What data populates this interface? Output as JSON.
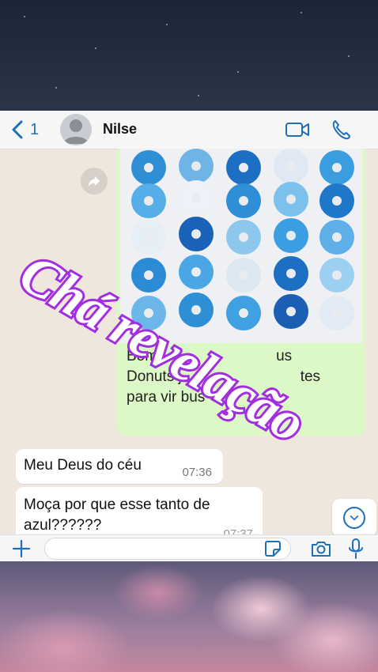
{
  "header": {
    "back_count": "1",
    "contact_name": "Nilse"
  },
  "chat": {
    "outgoing": {
      "caption_lines": [
        "Bom",
        "us",
        "Donuts j",
        "tes",
        "para vir bus"
      ]
    },
    "incoming": [
      {
        "text": "Meu Deus do céu",
        "time": "07:36"
      },
      {
        "text": "Moça por que esse tanto de azul??????",
        "time": "07:37"
      }
    ]
  },
  "input": {
    "placeholder": ""
  },
  "overlay": {
    "text": "Chá revelação"
  },
  "colors": {
    "accent": "#1f6fb8",
    "outgoing_bubble": "#dcf8c6",
    "overlay_fill": "#ffffff",
    "overlay_stroke": "#a12fe0"
  },
  "icons": [
    "chevron-left-icon",
    "avatar-icon",
    "video-call-icon",
    "phone-icon",
    "forward-icon",
    "chevron-down-icon",
    "plus-icon",
    "sticker-icon",
    "camera-icon",
    "microphone-icon"
  ]
}
